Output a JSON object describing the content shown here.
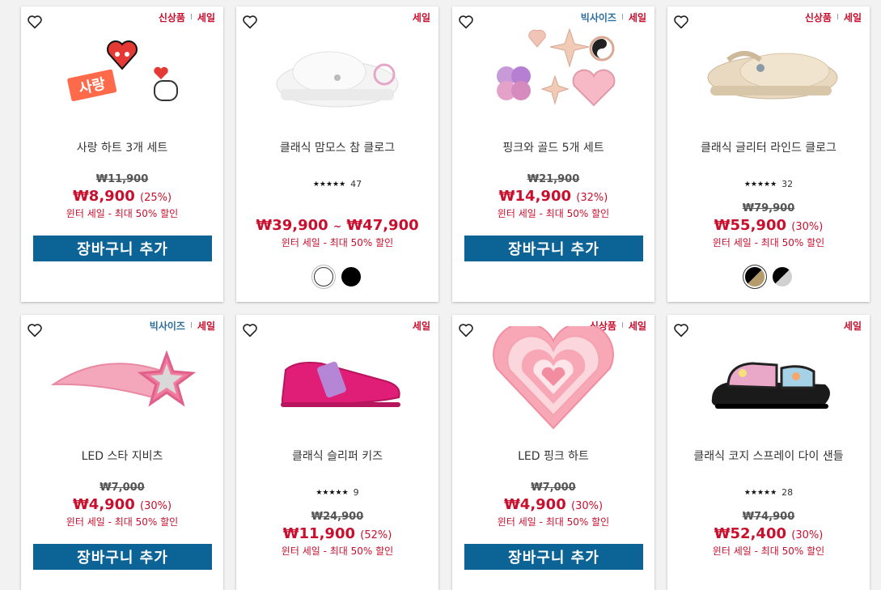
{
  "products": [
    {
      "name": "사랑 하트 3개 세트",
      "badges": [
        "신상품",
        "세일"
      ],
      "original_price": "₩11,900",
      "sale_price": "₩8,900",
      "discount": "(25%)",
      "promo": "윈터 세일 - 최대 50% 할인",
      "cart_label": "장바구니 추가"
    },
    {
      "name": "클래식 맘모스 참 클로그",
      "badges": [
        "세일"
      ],
      "rating_count": "47",
      "price_low": "₩39,900",
      "price_sep": "~",
      "price_high": "₩47,900",
      "promo": "윈터 세일 - 최대 50% 할인",
      "swatches": [
        "white",
        "black"
      ]
    },
    {
      "name": "핑크와 골드 5개 세트",
      "badges": [
        "빅사이즈",
        "세일"
      ],
      "original_price": "₩21,900",
      "sale_price": "₩14,900",
      "discount": "(32%)",
      "promo": "윈터 세일 - 최대 50% 할인",
      "cart_label": "장바구니 추가"
    },
    {
      "name": "클래식 글리터 라인드 클로그",
      "badges": [
        "신상품",
        "세일"
      ],
      "rating_count": "32",
      "original_price": "₩79,900",
      "sale_price": "₩55,900",
      "discount": "(30%)",
      "promo": "윈터 세일 - 최대 50% 할인",
      "swatches": [
        "black-gold",
        "silver"
      ]
    },
    {
      "name": "LED 스타 지비츠",
      "badges": [
        "빅사이즈",
        "세일"
      ],
      "original_price": "₩7,000",
      "sale_price": "₩4,900",
      "discount": "(30%)",
      "promo": "윈터 세일 - 최대 50% 할인",
      "cart_label": "장바구니 추가"
    },
    {
      "name": "클래식 슬리퍼 키즈",
      "badges": [
        "세일"
      ],
      "rating_count": "9",
      "original_price": "₩24,900",
      "sale_price": "₩11,900",
      "discount": "(52%)",
      "promo": "윈터 세일 - 최대 50% 할인"
    },
    {
      "name": "LED 핑크 하트",
      "badges": [
        "신상품",
        "세일"
      ],
      "original_price": "₩7,000",
      "sale_price": "₩4,900",
      "discount": "(30%)",
      "promo": "윈터 세일 - 최대 50% 할인",
      "cart_label": "장바구니 추가"
    },
    {
      "name": "클래식 코지 스프레이 다이 샌들",
      "badges": [
        "세일"
      ],
      "rating_count": "28",
      "original_price": "₩74,900",
      "sale_price": "₩52,400",
      "discount": "(30%)",
      "promo": "윈터 세일 - 최대 50% 할인"
    }
  ],
  "colors": {
    "sale_red": "#c8102e",
    "badge_blue": "#2b6d9c",
    "cart_blue": "#0c6496"
  },
  "icons": {
    "wishlist": "heart-outline-icon",
    "rating": "star-icon"
  }
}
